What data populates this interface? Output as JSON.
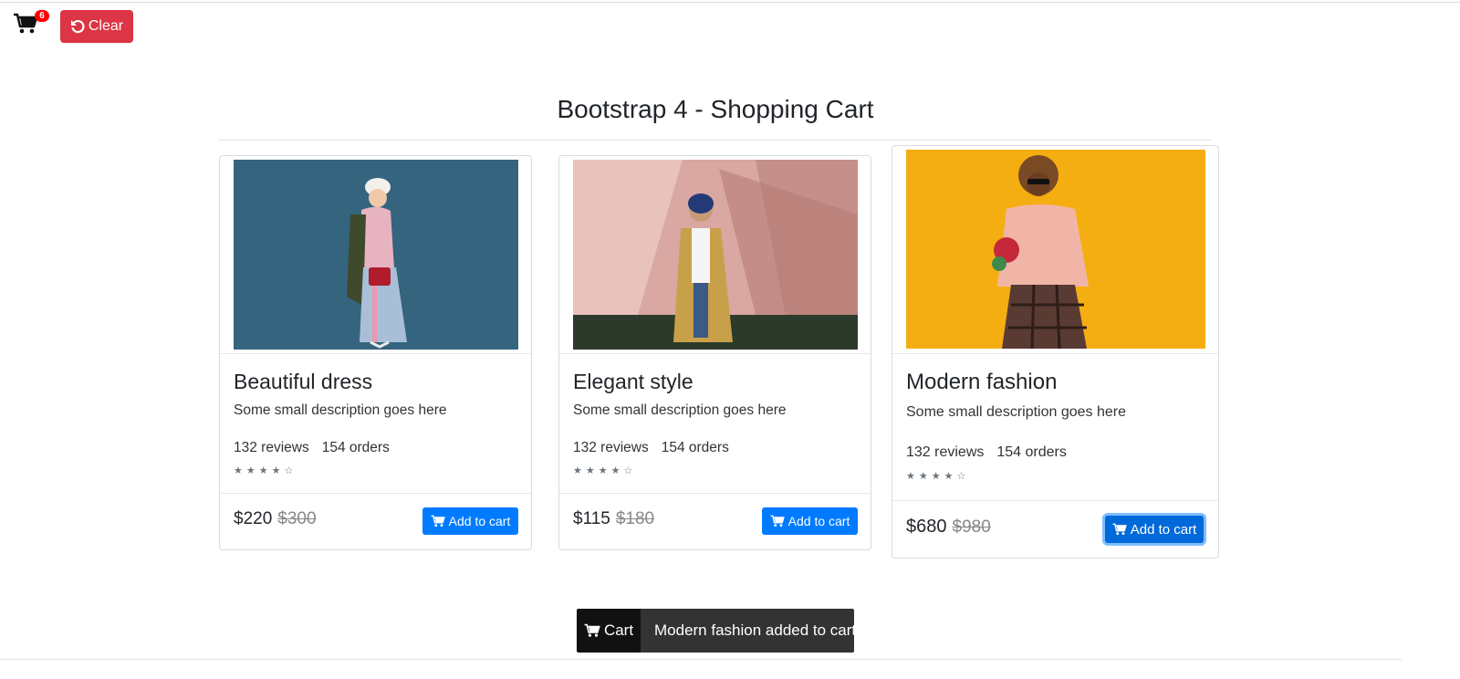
{
  "header": {
    "cart_count": "6",
    "clear_label": "Clear"
  },
  "page_title": "Bootstrap 4 - Shopping Cart",
  "products": [
    {
      "name": "Beautiful dress",
      "description": "Some small description goes here",
      "reviews": "132 reviews",
      "orders": "154 orders",
      "rating_stars": "★★★★☆",
      "price": "$220",
      "old_price": "$300",
      "button_label": "Add to cart"
    },
    {
      "name": "Elegant style",
      "description": "Some small description goes here",
      "reviews": "132 reviews",
      "orders": "154 orders",
      "rating_stars": "★★★★☆",
      "price": "$115",
      "old_price": "$180",
      "button_label": "Add to cart"
    },
    {
      "name": "Modern fashion",
      "description": "Some small description goes here",
      "reviews": "132 reviews",
      "orders": "154 orders",
      "rating_stars": "★★★★☆",
      "price": "$680",
      "old_price": "$980",
      "button_label": "Add to cart"
    }
  ],
  "toast": {
    "label": "Cart",
    "message": "Modern fashion added to cart"
  },
  "colors": {
    "primary": "#007bff",
    "danger": "#dc3545",
    "badge": "#ff0000",
    "toast_dark": "#111111",
    "toast_body": "#333333"
  }
}
